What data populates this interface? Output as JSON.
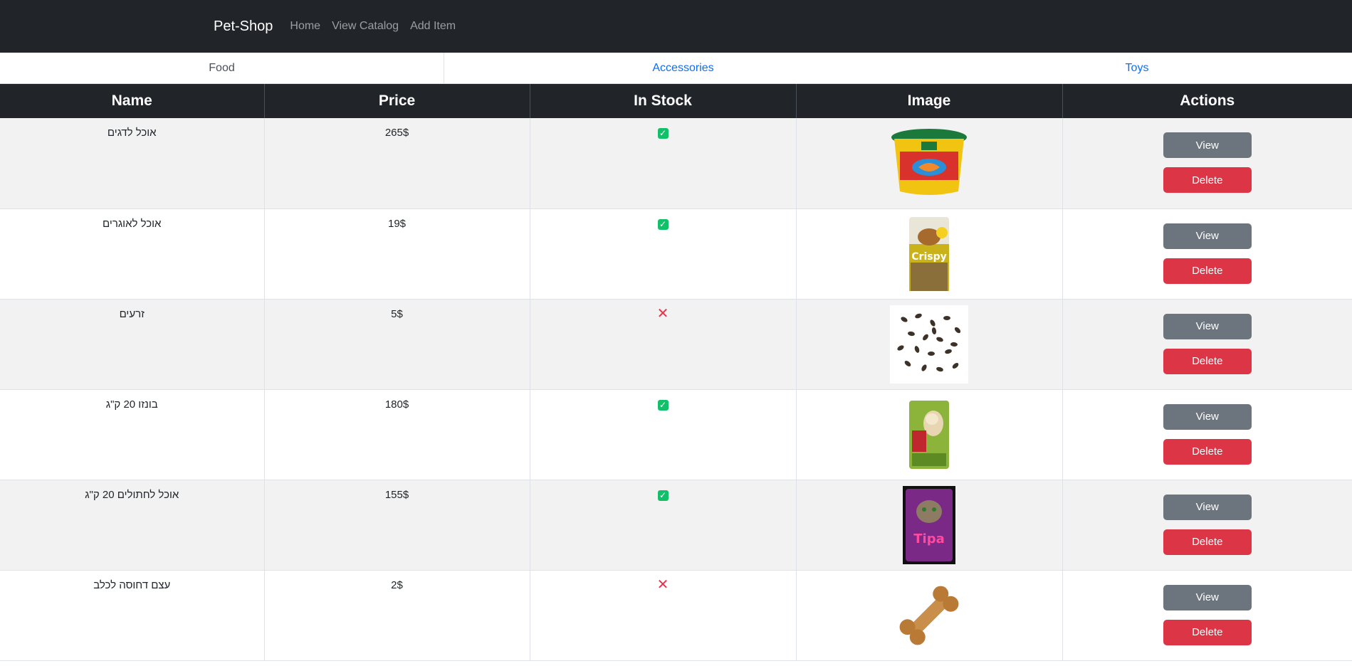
{
  "nav": {
    "brand": "Pet-Shop",
    "links": [
      "Home",
      "View Catalog",
      "Add Item"
    ]
  },
  "tabs": [
    {
      "label": "Food",
      "active": true
    },
    {
      "label": "Accessories",
      "active": false
    },
    {
      "label": "Toys",
      "active": false
    }
  ],
  "table": {
    "headers": [
      "Name",
      "Price",
      "In Stock",
      "Image",
      "Actions"
    ],
    "rows": [
      {
        "name": "אוכל לדגים",
        "price": "265$",
        "in_stock": true,
        "image": "fish-food-bucket-image"
      },
      {
        "name": "אוכל לאוגרים",
        "price": "19$",
        "in_stock": true,
        "image": "hamster-food-bag-image"
      },
      {
        "name": "זרעים",
        "price": "5$",
        "in_stock": false,
        "image": "seeds-image"
      },
      {
        "name": "בונזו 20 ק\"ג",
        "price": "180$",
        "in_stock": true,
        "image": "dog-food-bag-image"
      },
      {
        "name": "אוכל לחתולים 20 ק\"ג",
        "price": "155$",
        "in_stock": true,
        "image": "cat-food-bag-image"
      },
      {
        "name": "עצם דחוסה לכלב",
        "price": "2$",
        "in_stock": false,
        "image": "dog-bone-image"
      }
    ],
    "view_label": "View",
    "delete_label": "Delete"
  },
  "colors": {
    "navbar": "#212529",
    "link": "#0d6efd",
    "view_button": "#6c757d",
    "delete_button": "#dc3545",
    "in_stock": "#13c06a",
    "out_of_stock": "#e8334a"
  },
  "icons": {
    "in_stock": "checkbox-check-icon",
    "out_of_stock": "red-x-icon"
  }
}
